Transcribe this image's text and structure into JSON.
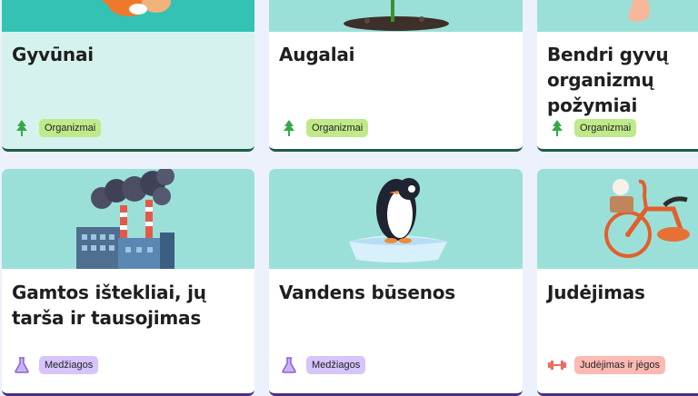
{
  "cards": [
    {
      "title": "Gyvūnai",
      "tag": "Organizmai",
      "tag_icon": "tree-icon",
      "tag_color": "#bfe98a",
      "image": "fox-illustration"
    },
    {
      "title": "Augalai",
      "tag": "Organizmai",
      "tag_icon": "tree-icon",
      "tag_color": "#bfe98a",
      "image": "sprout-illustration"
    },
    {
      "title": "Bendri gyvų organizmų požymiai",
      "tag": "Organizmai",
      "tag_icon": "tree-icon",
      "tag_color": "#bfe98a",
      "image": "hand-illustration"
    },
    {
      "title": "Gamtos ištekliai, jų tarša ir tausojimas",
      "tag": "Medžiagos",
      "tag_icon": "flask-icon",
      "tag_color": "#d6c4fb",
      "image": "factory-illustration"
    },
    {
      "title": "Vandens būsenos",
      "tag": "Medžiagos",
      "tag_icon": "flask-icon",
      "tag_color": "#d6c4fb",
      "image": "penguin-illustration"
    },
    {
      "title": "Judėjimas",
      "tag": "Judėjimas ir jėgos",
      "tag_icon": "dumbbell-icon",
      "tag_color": "#fdb9b3",
      "image": "bicycle-illustration"
    }
  ],
  "colors": {
    "page_background": "#edf1fb",
    "thumb_teal": "#9be0d8",
    "thumb_teal_dark": "#34c2b4",
    "card_top_light": "#d6f2ef"
  }
}
